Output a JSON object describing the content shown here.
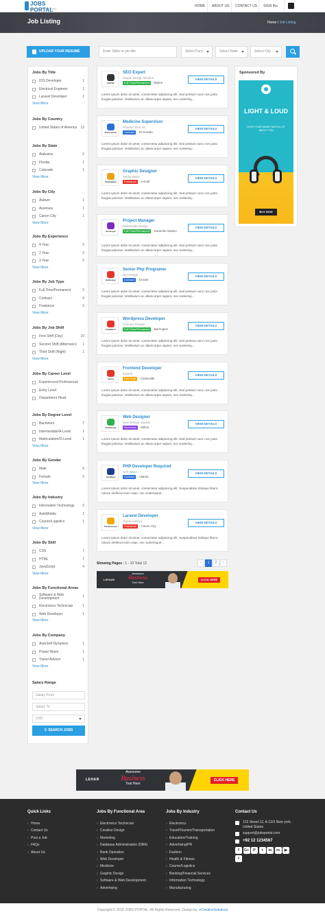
{
  "brand": {
    "name": "JOBS PORTAL",
    "tagline": "ONLINE JOBS PORTAL"
  },
  "nav": {
    "items": [
      "HOME",
      "ABOUT US",
      "CONTACT US",
      "SIGN IN"
    ]
  },
  "hero": {
    "title": "Job Listing",
    "crumb_home": "Home",
    "crumb_sep": "/",
    "crumb_current": "Job Listing"
  },
  "search": {
    "upload": "UPLOAD YOUR RESUME",
    "keyword_placeholder": "Enter Skills or job title",
    "func": "Select Func",
    "state": "Select State",
    "city": "Select City"
  },
  "filters": [
    {
      "title": "Jobs By Title",
      "items": [
        [
          "IOS Developer",
          "1"
        ],
        [
          "Electrical Engineer",
          "1"
        ],
        [
          "Laravel Developer",
          "1"
        ]
      ],
      "more": "View More"
    },
    {
      "title": "Jobs By Country",
      "items": [
        [
          "United States of America",
          "13"
        ]
      ],
      "more": ""
    },
    {
      "title": "Jobs By State",
      "items": [
        [
          "Alabama",
          "2"
        ],
        [
          "Florida",
          "1"
        ],
        [
          "Colorado",
          "1"
        ]
      ],
      "more": "View More"
    },
    {
      "title": "Jobs By City",
      "items": [
        [
          "Auburn",
          "1"
        ],
        [
          "Aventura",
          "1"
        ],
        [
          "Canon City",
          "1"
        ]
      ],
      "more": "View More"
    },
    {
      "title": "Jobs By Experience",
      "items": [
        [
          "4 Year",
          "3"
        ],
        [
          "2 Year",
          "3"
        ],
        [
          "3 Year",
          "2"
        ]
      ],
      "more": "View More"
    },
    {
      "title": "Jobs By Job Type",
      "items": [
        [
          "Full Time/Permanent",
          "3"
        ],
        [
          "Contract",
          "4"
        ],
        [
          "Freelance",
          "3"
        ]
      ],
      "more": "View More"
    },
    {
      "title": "Jobs By Job Shift",
      "items": [
        [
          "First Shift (Day)",
          "10"
        ],
        [
          "Second Shift (Afternoon)",
          "1"
        ],
        [
          "Third Shift (Night)",
          "1"
        ]
      ],
      "more": "View More"
    },
    {
      "title": "Jobs By Career Level",
      "items": [
        [
          "Experienced Professional",
          ""
        ],
        [
          "Entry Level",
          ""
        ],
        [
          "Department Head",
          ""
        ]
      ],
      "more": ""
    },
    {
      "title": "Jobs By Degree Level",
      "items": [
        [
          "Bachelors",
          "7"
        ],
        [
          "Intermediate/A-Level",
          "1"
        ],
        [
          "Matriculation/O-Level",
          "1"
        ]
      ],
      "more": "View More"
    },
    {
      "title": "Jobs By Gender",
      "items": [
        [
          "Male",
          "6"
        ],
        [
          "Female",
          "3"
        ]
      ],
      "more": "View More"
    },
    {
      "title": "Jobs By Industry",
      "items": [
        [
          "Information Technology",
          "3"
        ],
        [
          "AutoMobile",
          "1"
        ],
        [
          "Courier/Logistics",
          "1"
        ]
      ],
      "more": "View More"
    },
    {
      "title": "Jobs By Skill",
      "items": [
        [
          "CSS",
          "7"
        ],
        [
          "HTML",
          "7"
        ],
        [
          "JavaScript",
          "4"
        ]
      ],
      "more": "View More"
    },
    {
      "title": "Jobs By Functional Areas",
      "items": [
        [
          "Software & Web Development",
          "1"
        ],
        [
          "Electronics Technician",
          "1"
        ],
        [
          "Web Developer",
          "1"
        ]
      ],
      "more": "View More"
    },
    {
      "title": "Jobs By Company",
      "items": [
        [
          "AutoSoft Dynamics",
          "1"
        ],
        [
          "Power Wave",
          "1"
        ],
        [
          "Travel Advisor",
          "1"
        ]
      ],
      "more": "View More"
    }
  ],
  "salary": {
    "title": "Salary Range",
    "from": "Salary From",
    "to": "Salary To",
    "currency": "USD",
    "button": "SEARCH JOBS"
  },
  "jobs": [
    {
      "title": "SEO Expert",
      "company": "Mayan Design Studios",
      "type": "Full Time/Permanent",
      "color": "#2eb34a",
      "location": "- Blaine",
      "logo": "MAYAN",
      "mark": "#333333"
    },
    {
      "title": "Medicine Supervisor",
      "company": "Pharma Tech Inc",
      "type": "Contract",
      "color": "#2a6fd6",
      "location": "- El Dorado",
      "logo": "PharmaTech",
      "mark": "#2a6fd6"
    },
    {
      "title": "Graphic Designer",
      "company": "Media Wave",
      "type": "Freelance",
      "color": "#e5342a",
      "location": "- Arnold",
      "logo": "MediaWave",
      "mark": "#e8a317"
    },
    {
      "title": "Project Manager",
      "company": "Multimedia Design",
      "type": "Full Time/Permanent",
      "color": "#2eb34a",
      "location": "- Kaneohe Station",
      "logo": "Developer",
      "mark": "#7b2cbf"
    },
    {
      "title": "Senior Php Programer",
      "company": "Net Design",
      "type": "Contract",
      "color": "#2a6fd6",
      "location": "- Durant",
      "logo": "NetDesign",
      "mark": "#e5342a"
    },
    {
      "title": "Wordpress Developer",
      "company": "Connect People",
      "type": "Full Time/Permanent",
      "color": "#2eb34a",
      "location": "- Barrington",
      "logo": "CONNECT",
      "mark": "#e5342a"
    },
    {
      "title": "Frontend Developer",
      "company": "Sphere",
      "type": "Part Time",
      "color": "#f0a800",
      "location": "- Clarksville",
      "logo": "sphere",
      "mark": "#e5342a"
    },
    {
      "title": "Web Designer",
      "company": "New Design Studios",
      "type": "Internship",
      "color": "#8c41e0",
      "location": "- Milton",
      "logo": "NewDesign",
      "mark": "#2eb34a"
    },
    {
      "title": "PHP Developer Required",
      "company": "Surf Wave",
      "type": "Contract",
      "color": "#2a6fd6",
      "location": "- Atlanta",
      "logo": "SurfWave",
      "mark": "#1b3f8f"
    },
    {
      "title": "Laravel Developer",
      "company": "Travel Advisor",
      "type": "Freelance",
      "color": "#e5342a",
      "location": "- Canon City",
      "logo": "TravelAdvisor",
      "mark": "#f0a800"
    }
  ],
  "job_desc": "Lorem ipsum dolor sit amet, consectetur adipiscing elit. Sed pretium nunc non justo feugiat pulvinar. Vestibulum ac ullamcorper sapien, nec scelerisq...",
  "job_desc_alt": "Lorem ipsum dolor sit amet, consectetur adipiscing elit. Suspendisse tristique libero, rutrum eleifend enim vitae, nec scelerisque...",
  "view_details": "VIEW DETAILS",
  "pagination": {
    "label": "Showing Pages :",
    "range": "1 - 10 Total 12",
    "prev": "‹",
    "pages": [
      "1",
      "2"
    ],
    "next": "›"
  },
  "banner": {
    "brand": "LEHAR",
    "line1": "Awesome",
    "line2": "Business",
    "line3": "Text Here",
    "cta": "CLICK HERE"
  },
  "sponsor": {
    "title": "Sponsored By",
    "ad_title": "LIGHT & LOUD",
    "ad_sub": "LIGHT YOUR MUSIC SAYS A LOT ABOUT YOU",
    "ad_btn": "BUY NOW"
  },
  "footer": {
    "quick_title": "Quick Links",
    "quick": [
      "Home",
      "Contact Us",
      "Post a Job",
      "FAQs",
      "About Us"
    ],
    "func_title": "Jobs By Functional Area",
    "func": [
      "Electronics Technician",
      "Creative Design",
      "Marketing",
      "Database Administration (DBA)",
      "Bank Operation",
      "Web Developer",
      "Medicine",
      "Graphic Design",
      "Software & Web Development",
      "Advertising"
    ],
    "ind_title": "Jobs By Industry",
    "ind": [
      "Electronics",
      "Travel/Tourism/Transportation",
      "Education/Training",
      "Advertising/PR",
      "Fashion",
      "Health & Fitness",
      "Courier/Logistics",
      "Banking/Financial Services",
      "Information Technology",
      "Manufacturing"
    ],
    "contact_title": "Contact Us",
    "address": "123 Street 12, A-12/3 New york, United States",
    "email": "support@jobsportal.com",
    "phone": "+92 12 1234567",
    "social": [
      "f",
      "G+",
      "P",
      "t",
      "in",
      "in",
      "▶",
      "t"
    ]
  },
  "copyright": "Copyright © 2018 JOBS PORTAL. All Rights Reserved. Design by:",
  "designer": "eCreativeSolutions"
}
